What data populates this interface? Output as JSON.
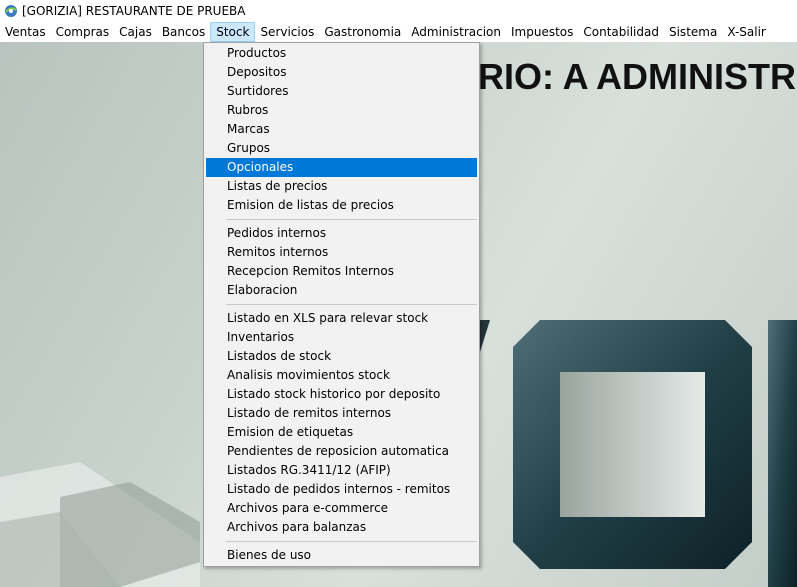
{
  "window": {
    "title": "[GORIZIA] RESTAURANTE DE PRUEBA"
  },
  "menubar": {
    "items": [
      "Ventas",
      "Compras",
      "Cajas",
      "Bancos",
      "Stock",
      "Servicios",
      "Gastronomia",
      "Administracion",
      "Impuestos",
      "Contabilidad",
      "Sistema",
      "X-Salir"
    ],
    "active": "Stock"
  },
  "desktop": {
    "banner": "RIO: A ADMINISTR"
  },
  "stock_menu": {
    "selected": "Opcionales",
    "groups": [
      [
        "Productos",
        "Depositos",
        "Surtidores",
        "Rubros",
        "Marcas",
        "Grupos",
        "Opcionales",
        "Listas de precios",
        "Emision de listas de precios"
      ],
      [
        "Pedidos internos",
        "Remitos internos",
        "Recepcion Remitos Internos",
        "Elaboracion"
      ],
      [
        "Listado en XLS para relevar stock",
        "Inventarios",
        "Listados de stock",
        "Analisis movimientos stock",
        "Listado stock historico por  deposito",
        "Listado de remitos internos",
        "Emision de etiquetas",
        "Pendientes de reposicion automatica",
        "Listados RG.3411/12 (AFIP)",
        "Listado de pedidos internos - remitos",
        "Archivos para e-commerce",
        "Archivos para balanzas"
      ],
      [
        "Bienes de uso"
      ]
    ]
  }
}
